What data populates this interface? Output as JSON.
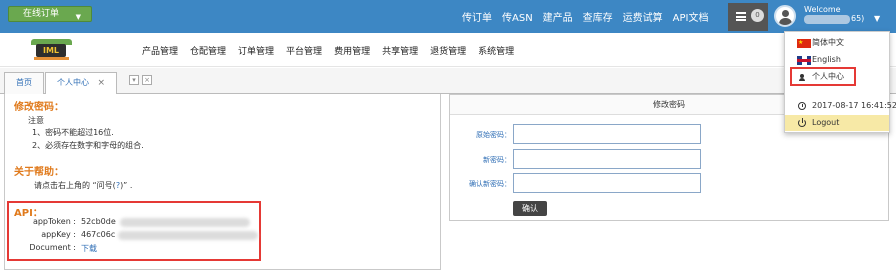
{
  "topbar": {
    "online_order": "在线订单",
    "links": [
      "传订单",
      "传ASN",
      "建产品",
      "查库存",
      "运费试算",
      "API文档"
    ],
    "badge_count": "0",
    "welcome": "Welcome",
    "user_id": "65)"
  },
  "nav": {
    "logo_text": "IML",
    "items": [
      "产品管理",
      "仓配管理",
      "订单管理",
      "平台管理",
      "费用管理",
      "共享管理",
      "退货管理",
      "系统管理"
    ]
  },
  "tabs": {
    "home": "首页",
    "active": "个人中心",
    "close": "×"
  },
  "left": {
    "change_password_title": "修改密码：",
    "note_label": "注意",
    "note_1": "1、密码不能超过16位.",
    "note_2": "2、必须存在数字和字母的组合.",
    "help_title": "关于帮助：",
    "help_text_1": "请点击右上角的 “问号(",
    "help_link": "?",
    "help_text_2": ")” .",
    "api_title": "API：",
    "api_token_label": "appToken :",
    "api_token_value": "52cb0de",
    "api_key_label": "appKey :",
    "api_key_value": "467c06c",
    "document_label": "Document :",
    "document_link": "下载"
  },
  "right": {
    "title": "修改密码",
    "old_password_label": "原始密码：",
    "new_password_label": "新密码：",
    "confirm_password_label": "确认新密码：",
    "confirm_button": "确认"
  },
  "dropdown": {
    "lang_cn": "简体中文",
    "lang_en": "English",
    "personal_center": "个人中心",
    "datetime": "2017-08-17 16:41:52",
    "logout": "Logout"
  }
}
